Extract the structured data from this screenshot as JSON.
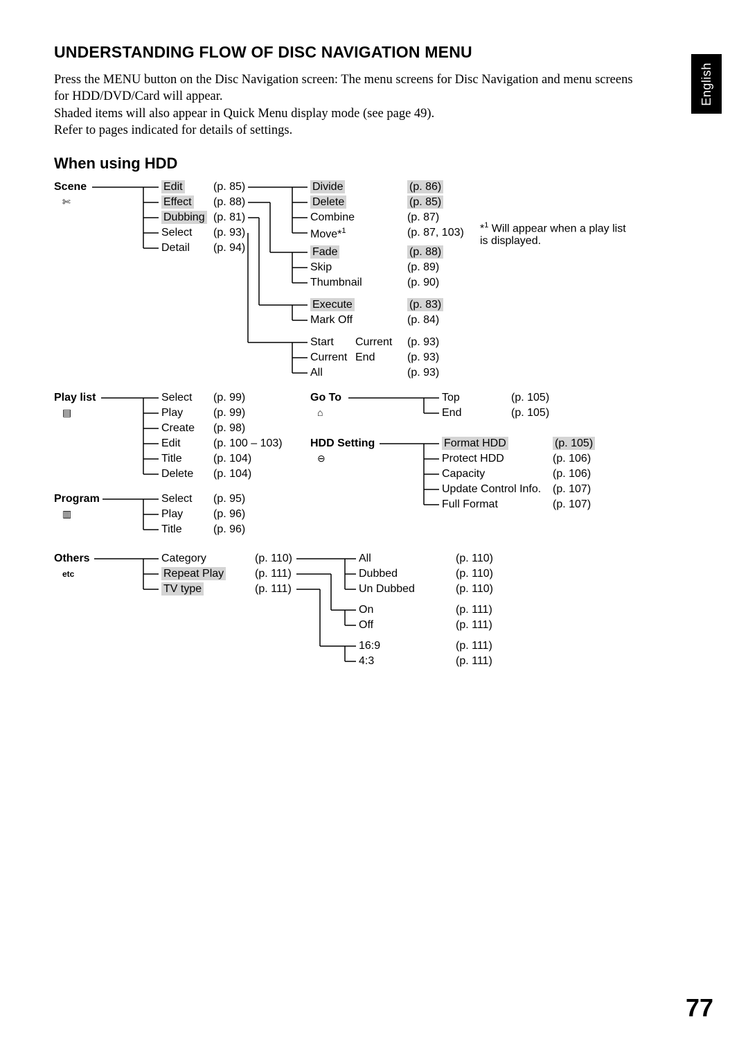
{
  "lang_tab": "English",
  "page_title": "UNDERSTANDING FLOW OF DISC NAVIGATION MENU",
  "intro_lines": [
    "Press the MENU button on the Disc Navigation screen: The menu screens for Disc Navigation and menu screens for HDD/DVD/Card will appear.",
    "Shaded items will also appear in Quick Menu display mode (see page 49).",
    "Refer to pages indicated for details of settings."
  ],
  "section_title": "When using HDD",
  "footnote": "*1 Will appear when a play list is displayed.",
  "page_number": "77",
  "roots": {
    "scene": {
      "label": "Scene",
      "icon": "✄"
    },
    "playlist": {
      "label": "Play list",
      "icon": "▤"
    },
    "program": {
      "label": "Program",
      "icon": "▥"
    },
    "others": {
      "label": "Others",
      "icon": "etc"
    },
    "goto": {
      "label": "Go To",
      "icon": "⌂"
    },
    "hddset": {
      "label": "HDD Setting",
      "icon": "⊖"
    }
  },
  "scene_children": [
    {
      "label": "Edit",
      "page": "(p. 85)",
      "shaded": true
    },
    {
      "label": "Effect",
      "page": "(p. 88)",
      "shaded": true
    },
    {
      "label": "Dubbing",
      "page": "(p. 81)",
      "shaded": true
    },
    {
      "label": "Select",
      "page": "(p. 93)"
    },
    {
      "label": "Detail",
      "page": "(p. 94)"
    }
  ],
  "edit_children": [
    {
      "label": "Divide",
      "page": "(p. 86)",
      "shaded": true
    },
    {
      "label": "Delete",
      "page": "(p. 85)",
      "shaded": true
    },
    {
      "label": "Combine",
      "page": "(p. 87)"
    },
    {
      "label": "Move*1",
      "page": "(p. 87, 103)"
    }
  ],
  "effect_children": [
    {
      "label": "Fade",
      "page": "(p. 88)",
      "shaded": true
    },
    {
      "label": "Skip",
      "page": "(p. 89)"
    },
    {
      "label": "Thumbnail",
      "page": "(p. 90)"
    }
  ],
  "dubbing_children": [
    {
      "label": "Execute",
      "page": "(p. 83)",
      "shaded": true
    },
    {
      "label": "Mark Off",
      "page": "(p. 84)"
    }
  ],
  "select_children": [
    {
      "label": "Start",
      "extra": "Current",
      "page": "(p. 93)"
    },
    {
      "label": "Current",
      "extra": "End",
      "page": "(p. 93)"
    },
    {
      "label": "All",
      "extra": "",
      "page": "(p. 93)"
    }
  ],
  "playlist_children": [
    {
      "label": "Select",
      "page": "(p. 99)"
    },
    {
      "label": "Play",
      "page": "(p. 99)"
    },
    {
      "label": "Create",
      "page": "(p. 98)"
    },
    {
      "label": "Edit",
      "page": "(p. 100 – 103)"
    },
    {
      "label": "Title",
      "page": "(p. 104)"
    },
    {
      "label": "Delete",
      "page": "(p. 104)"
    }
  ],
  "goto_children": [
    {
      "label": "Top",
      "page": "(p. 105)"
    },
    {
      "label": "End",
      "page": "(p. 105)"
    }
  ],
  "hddset_children": [
    {
      "label": "Format HDD",
      "page": "(p. 105)",
      "shaded": true
    },
    {
      "label": "Protect HDD",
      "page": "(p. 106)"
    },
    {
      "label": "Capacity",
      "page": "(p. 106)"
    },
    {
      "label": "Update Control Info.",
      "page": "(p. 107)"
    },
    {
      "label": "Full Format",
      "page": "(p. 107)"
    }
  ],
  "program_children": [
    {
      "label": "Select",
      "page": "(p. 95)"
    },
    {
      "label": "Play",
      "page": "(p. 96)"
    },
    {
      "label": "Title",
      "page": "(p. 96)"
    }
  ],
  "others_children": [
    {
      "label": "Category",
      "page": "(p. 110)"
    },
    {
      "label": "Repeat Play",
      "page": "(p. 111)",
      "shaded": true
    },
    {
      "label": "TV type",
      "page": "(p. 111)",
      "shaded": true
    }
  ],
  "category_children": [
    {
      "label": "All",
      "page": "(p. 110)"
    },
    {
      "label": "Dubbed",
      "page": "(p. 110)"
    },
    {
      "label": "Un Dubbed",
      "page": "(p. 110)"
    }
  ],
  "repeat_children": [
    {
      "label": "On",
      "page": "(p. 111)"
    },
    {
      "label": "Off",
      "page": "(p. 111)"
    }
  ],
  "tvtype_children": [
    {
      "label": "16:9",
      "page": "(p. 111)"
    },
    {
      "label": "4:3",
      "page": "(p. 111)"
    }
  ]
}
